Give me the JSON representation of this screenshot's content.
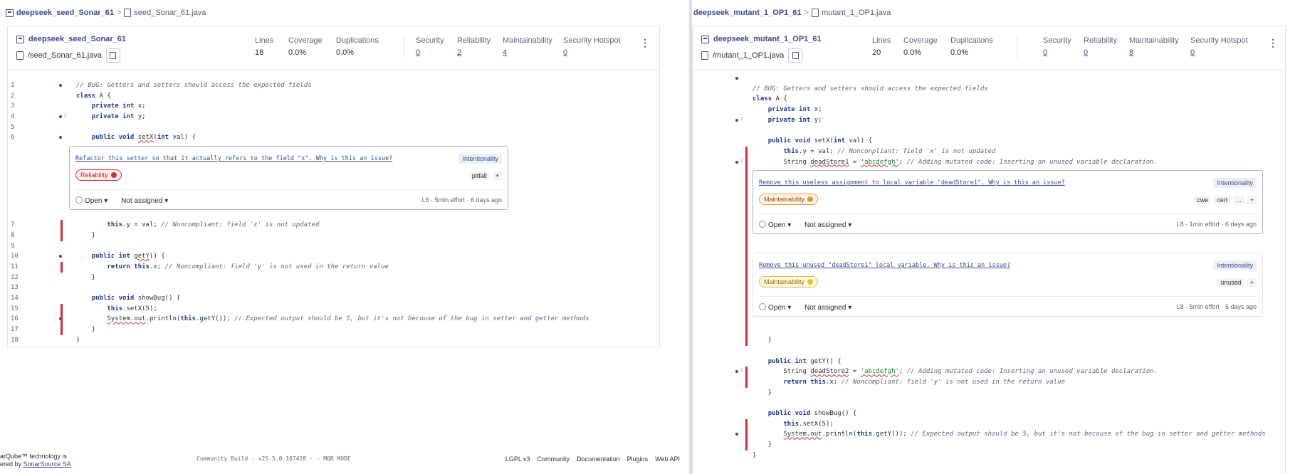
{
  "left": {
    "breadcrumb": {
      "project": "deepseek_seed_Sonar_61",
      "separator": ">",
      "file": "seed_Sonar_61.java"
    },
    "header": {
      "project": "deepseek_seed_Sonar_61",
      "file_path": "/seed_Sonar_61.java",
      "metrics": {
        "lines_label": "Lines",
        "lines": "18",
        "coverage_label": "Coverage",
        "coverage": "0.0%",
        "duplications_label": "Duplications",
        "duplications": "0.0%",
        "security_label": "Security",
        "security": "0",
        "reliability_label": "Reliability",
        "reliability": "2",
        "maintainability_label": "Maintainability",
        "maintainability": "4",
        "hotspot_label": "Security Hotspot",
        "hotspot": "0"
      }
    },
    "issue": {
      "message": "Refactor this setter so that it actually refers to the field \"x\". Why is this an issue?",
      "category": "Intentionality",
      "quality": "Reliability",
      "tags": [
        "pitfall",
        "+"
      ],
      "status": "Open",
      "assignee": "Not assigned",
      "effort": "L6 · 5min effort · 6 days ago"
    }
  },
  "right": {
    "breadcrumb": {
      "project": "deepseek_mutant_1_OP1_61",
      "separator": ">",
      "file": "mutant_1_OP1.java"
    },
    "header": {
      "project": "deepseek_mutant_1_OP1_61",
      "file_path": "/mutant_1_OP1.java",
      "metrics": {
        "lines_label": "Lines",
        "lines": "20",
        "coverage_label": "Coverage",
        "coverage": "0.0%",
        "duplications_label": "Duplications",
        "duplications": "0.0%",
        "security_label": "Security",
        "security": "0",
        "reliability_label": "Reliability",
        "reliability": "0",
        "maintainability_label": "Maintainability",
        "maintainability": "8",
        "hotspot_label": "Security Hotspot",
        "hotspot": "0"
      }
    },
    "issue1": {
      "message": "Remove this useless assignment to local variable \"deadStore1\". Why is this an issue?",
      "category": "Intentionality",
      "quality": "Maintainability",
      "tags": [
        "cwe",
        "cert",
        "...",
        "+"
      ],
      "status": "Open",
      "assignee": "Not assigned",
      "effort": "L8 · 1min effort · 6 days ago"
    },
    "issue2": {
      "message": "Remove this unused \"deadStore1\" local variable. Why is this an issue?",
      "category": "Intentionality",
      "quality": "Maintainability",
      "tags": [
        "unused",
        "+"
      ],
      "status": "Open",
      "assignee": "Not assigned",
      "effort": "L8 · 5min effort · 6 days ago"
    }
  },
  "footer": {
    "powered_1": "arQube™ technology is",
    "powered_2": "ered by",
    "powered_link": "SonarSource SA",
    "build": "Community Build - v25.5.0.107428 - - MQR MODE",
    "links": [
      "LGPL v3",
      "Community",
      "Documentation",
      "Plugins",
      "Web API"
    ]
  },
  "colors": {
    "accent": "#3a4a8f",
    "issue_red": "#d02f3a",
    "maintainability": "#e09a3a"
  }
}
